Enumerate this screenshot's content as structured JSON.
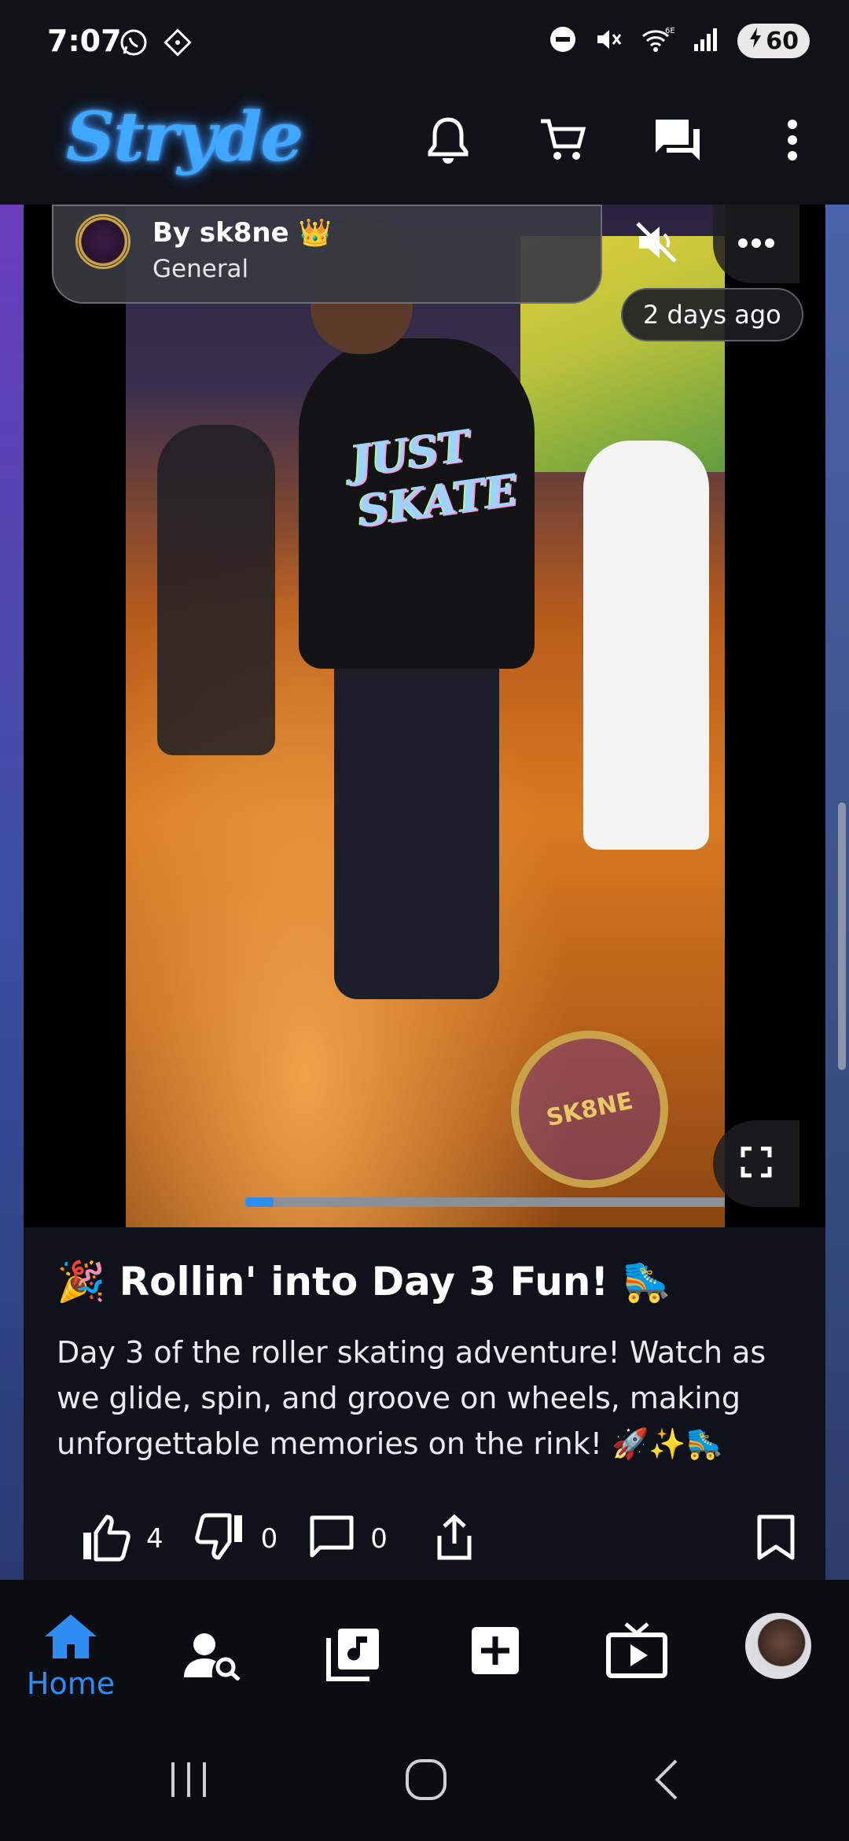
{
  "status_bar": {
    "time": "7:07",
    "battery": "60",
    "icons": [
      "whatsapp-icon",
      "location-diamond-icon",
      "dnd-icon",
      "mute-icon",
      "wifi-6e-icon",
      "signal-icon",
      "battery-charging-icon"
    ]
  },
  "header": {
    "brand": "Stryde",
    "icons": [
      "bell-icon",
      "cart-icon",
      "chat-icon",
      "more-vert-icon"
    ]
  },
  "post": {
    "author": "By sk8ne 👑",
    "category": "General",
    "time_ago": "2 days ago",
    "video_progress": 0.05,
    "title": "🎉 Rollin' into Day 3 Fun! 🛼",
    "body": "Day 3 of the roller skating adventure! Watch as we glide, spin, and groove on wheels, making unforgettable memories on the rink! 🚀✨🛼",
    "likes": "4",
    "dislikes": "0",
    "comments": "0"
  },
  "bottom_nav": {
    "home_label": "Home",
    "active": "Home",
    "items": [
      "home-icon",
      "people-search-icon",
      "music-library-icon",
      "add-box-icon",
      "live-tv-icon",
      "profile-avatar"
    ]
  },
  "colors": {
    "accent": "#2f8cf0",
    "brand_glow": "#3fa7ff",
    "background": "#10121a"
  }
}
